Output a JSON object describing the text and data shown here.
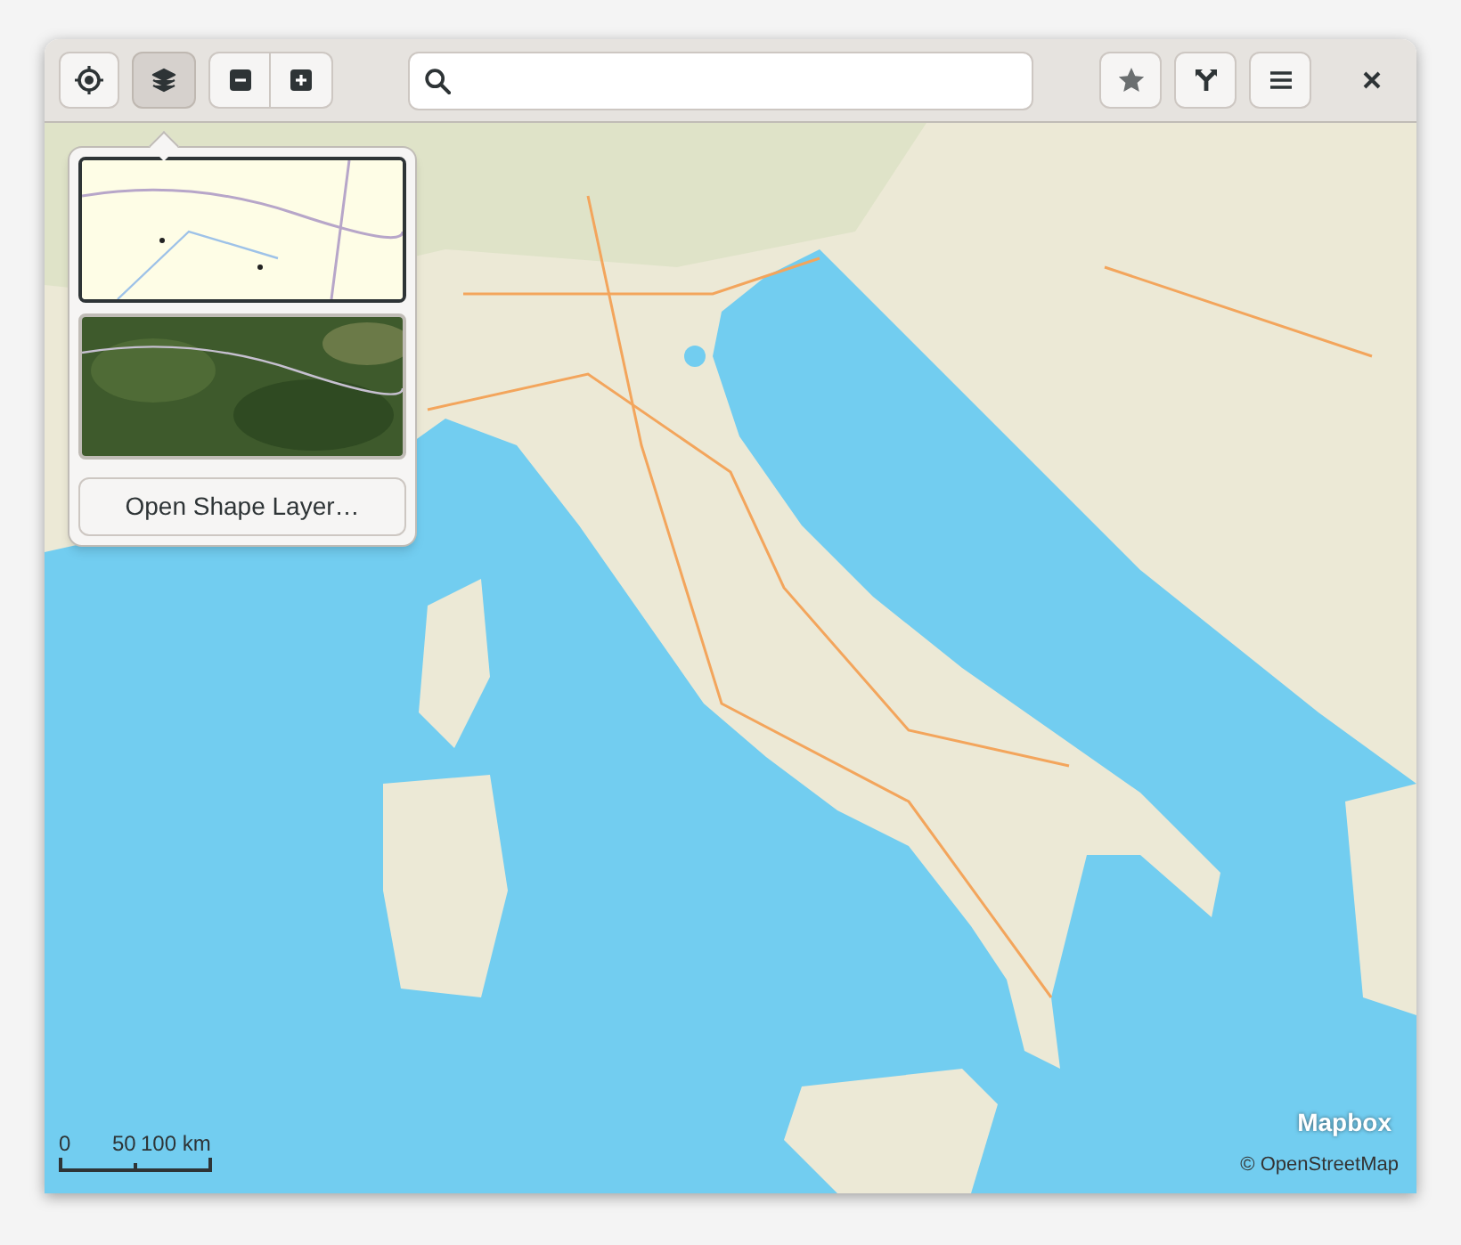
{
  "header": {
    "layers_button": {
      "selected": true
    }
  },
  "layers_popover": {
    "layers": [
      {
        "kind": "picture",
        "selected": true
      },
      {
        "kind": "picture",
        "selected": false
      }
    ],
    "button": "Open Shape Layer…"
  },
  "map": {
    "kind": "picture"
  },
  "scale": {
    "labels": [
      "0",
      "50",
      "100 km"
    ]
  },
  "logo": "Mapbox",
  "attribution": "© OpenStreetMap"
}
